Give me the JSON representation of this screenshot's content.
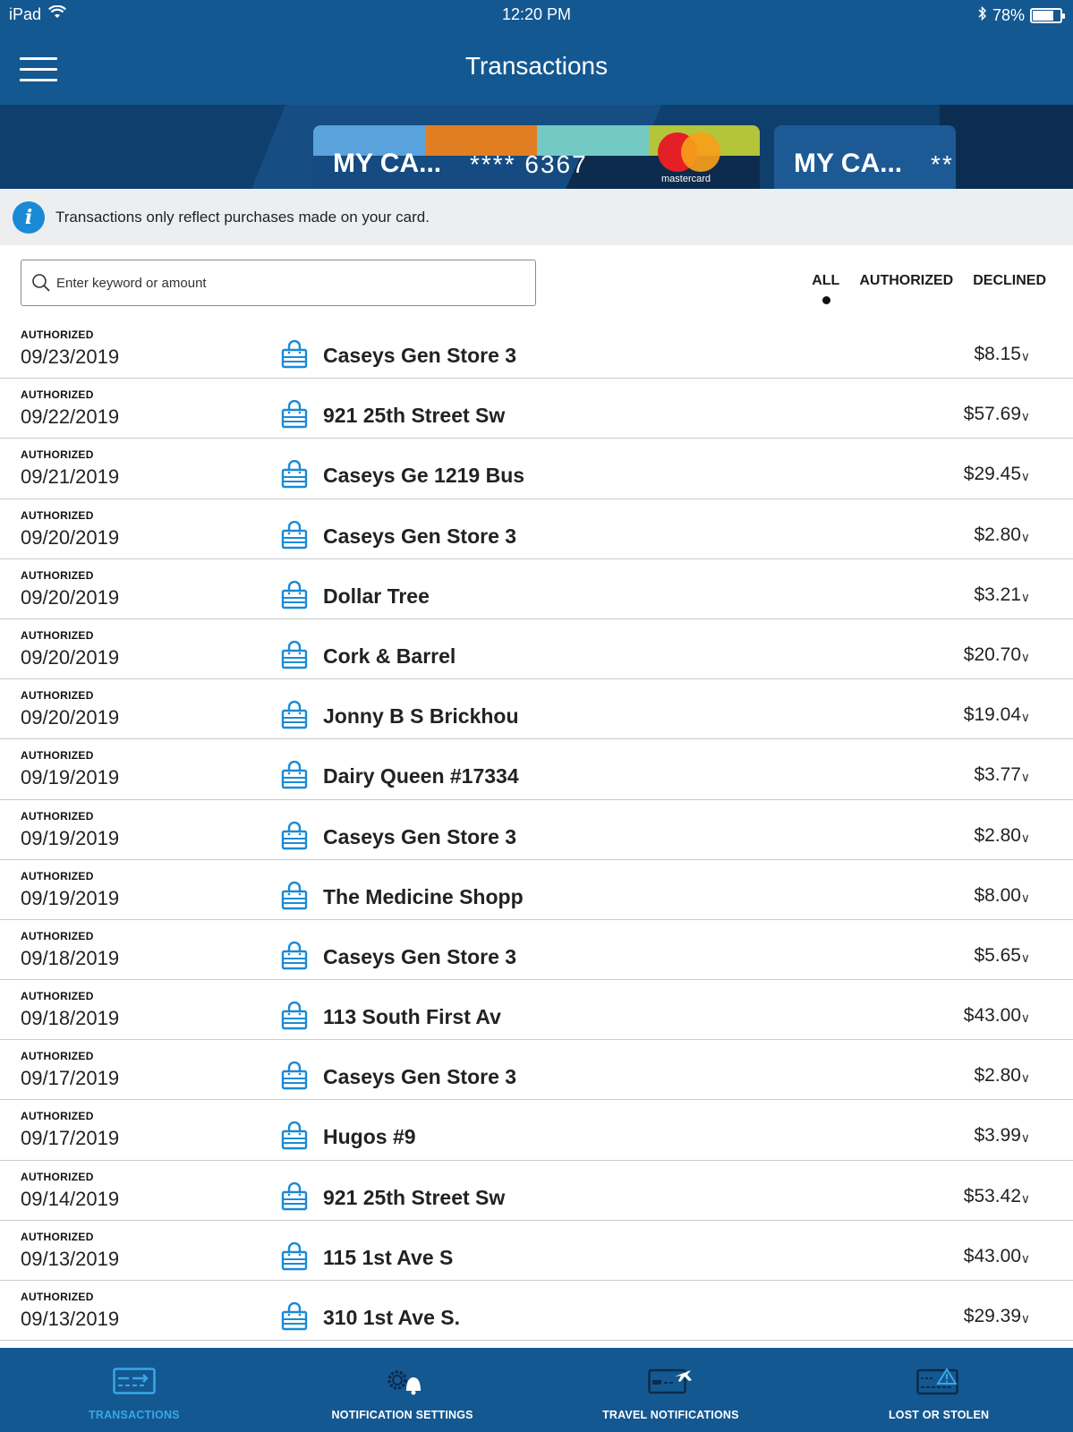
{
  "status_bar": {
    "device": "iPad",
    "time": "12:20 PM",
    "battery_percent": "78%",
    "battery_level": 0.78
  },
  "header": {
    "title": "Transactions",
    "menu_icon": "hamburger-menu-icon"
  },
  "cards": [
    {
      "name": "MY CA...",
      "number": "**** 6367",
      "brand": "mastercard",
      "stripe_colors": [
        "#5aa2dc",
        "#e27e22",
        "#73cac4",
        "#b4c53a"
      ]
    },
    {
      "name": "MY CA...",
      "number": "**"
    }
  ],
  "info_banner": {
    "icon": "info-icon",
    "text": "Transactions only reflect purchases made on your card."
  },
  "search": {
    "placeholder": "Enter keyword or amount",
    "value": ""
  },
  "filters": {
    "all": "ALL",
    "authorized": "AUTHORIZED",
    "declined": "DECLINED",
    "selected": "ALL"
  },
  "transactions": [
    {
      "status": "AUTHORIZED",
      "date": "09/23/2019",
      "merchant": "Caseys Gen Store 3",
      "amount": "$8.15"
    },
    {
      "status": "AUTHORIZED",
      "date": "09/22/2019",
      "merchant": "921 25th Street Sw",
      "amount": "$57.69"
    },
    {
      "status": "AUTHORIZED",
      "date": "09/21/2019",
      "merchant": "Caseys Ge 1219 Bus",
      "amount": "$29.45"
    },
    {
      "status": "AUTHORIZED",
      "date": "09/20/2019",
      "merchant": "Caseys Gen Store 3",
      "amount": "$2.80"
    },
    {
      "status": "AUTHORIZED",
      "date": "09/20/2019",
      "merchant": "Dollar Tree",
      "amount": "$3.21"
    },
    {
      "status": "AUTHORIZED",
      "date": "09/20/2019",
      "merchant": "Cork & Barrel",
      "amount": "$20.70"
    },
    {
      "status": "AUTHORIZED",
      "date": "09/20/2019",
      "merchant": "Jonny B S Brickhou",
      "amount": "$19.04"
    },
    {
      "status": "AUTHORIZED",
      "date": "09/19/2019",
      "merchant": "Dairy Queen #17334",
      "amount": "$3.77"
    },
    {
      "status": "AUTHORIZED",
      "date": "09/19/2019",
      "merchant": "Caseys Gen Store 3",
      "amount": "$2.80"
    },
    {
      "status": "AUTHORIZED",
      "date": "09/19/2019",
      "merchant": "The Medicine Shopp",
      "amount": "$8.00"
    },
    {
      "status": "AUTHORIZED",
      "date": "09/18/2019",
      "merchant": "Caseys Gen Store 3",
      "amount": "$5.65"
    },
    {
      "status": "AUTHORIZED",
      "date": "09/18/2019",
      "merchant": "113 South First Av",
      "amount": "$43.00"
    },
    {
      "status": "AUTHORIZED",
      "date": "09/17/2019",
      "merchant": "Caseys Gen Store 3",
      "amount": "$2.80"
    },
    {
      "status": "AUTHORIZED",
      "date": "09/17/2019",
      "merchant": "Hugos #9",
      "amount": "$3.99"
    },
    {
      "status": "AUTHORIZED",
      "date": "09/14/2019",
      "merchant": "921 25th Street Sw",
      "amount": "$53.42"
    },
    {
      "status": "AUTHORIZED",
      "date": "09/13/2019",
      "merchant": "115 1st Ave S",
      "amount": "$43.00"
    },
    {
      "status": "AUTHORIZED",
      "date": "09/13/2019",
      "merchant": "310 1st Ave S.",
      "amount": "$29.39"
    }
  ],
  "tabbar": {
    "tabs": [
      {
        "label": "TRANSACTIONS",
        "icon": "card-transfer-icon",
        "active": true
      },
      {
        "label": "NOTIFICATION SETTINGS",
        "icon": "gear-bell-icon",
        "active": false
      },
      {
        "label": "TRAVEL NOTIFICATIONS",
        "icon": "card-plane-icon",
        "active": false
      },
      {
        "label": "LOST OR STOLEN",
        "icon": "card-warning-icon",
        "active": false
      }
    ]
  },
  "colors": {
    "primary": "#145891",
    "accent": "#1a8ad6",
    "active_tab": "#38a7e6",
    "divider": "#c8ccd0",
    "banner_bg": "#eceef0"
  }
}
